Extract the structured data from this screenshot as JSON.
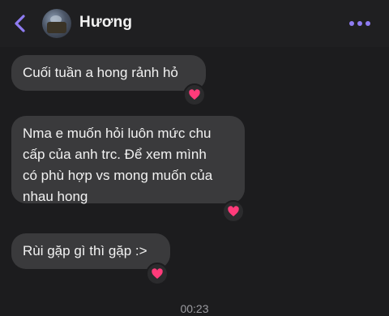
{
  "header": {
    "contact_name": "Hương",
    "back_icon": "chevron-left-icon",
    "more_icon": "ellipsis-icon",
    "accent_color": "#8f7cf2"
  },
  "messages": [
    {
      "text": "Cuối tuần a hong rảnh hỏ",
      "reaction": "heart"
    },
    {
      "text": "Nma e muốn hỏi luôn mức chu\ncấp của anh trc. Để xem mình\ncó phù hợp vs mong muốn của\nnhau hong",
      "reaction": "heart"
    },
    {
      "text": "Rùi gặp gì thì gặp :>",
      "reaction": "heart"
    }
  ],
  "timestamp": "00:23",
  "colors": {
    "background": "#1c1c1e",
    "bubble": "#3a3a3c",
    "heart": "#ff3b7a"
  }
}
